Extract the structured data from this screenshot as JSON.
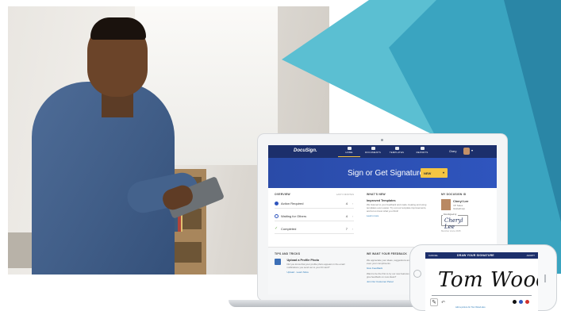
{
  "nav": {
    "logo": "DocuSign.",
    "items": [
      {
        "label": "HOME",
        "active": true
      },
      {
        "label": "DOCUMENTS",
        "active": false
      },
      {
        "label": "TEMPLATES",
        "active": false
      },
      {
        "label": "REPORTS",
        "active": false
      }
    ],
    "user_name": "Chery"
  },
  "hero": {
    "title": "Sign or Get Signatures",
    "new_button": "NEW"
  },
  "overview": {
    "heading": "OVERVIEW",
    "subheading": "LAST 6 MONTHS",
    "rows": [
      {
        "label": "Action Required",
        "count": "4",
        "color": "#2f55be"
      },
      {
        "label": "Waiting for Others",
        "count": "4",
        "color": "#2f55be"
      },
      {
        "label": "Completed",
        "count": "7",
        "color": "#6aa84f"
      }
    ]
  },
  "whats_new": {
    "heading": "WHAT'S NEW",
    "title": "Improved Templates",
    "body": "We listened to your feedback and made creating and using templates even easier. Try out our template improvements, and let us know what you think!",
    "link": "Learn more"
  },
  "identity": {
    "heading": "MY DOCUSIGN ID",
    "name": "Cheryl Lee",
    "role": "VP Sales",
    "company": "GlobalCorp",
    "sig_label": "DocuSigned by:",
    "signature": "Cheryl Lee",
    "date": "Member since 2015"
  },
  "tips": {
    "heading": "TIPS AND TRICKS",
    "title": "Upload a Profile Photo",
    "body": "Did you know that your profile photo appears in the email notifications you send out to your ID card?",
    "link": "Upload · Learn More"
  },
  "feedback": {
    "heading": "WE WANT YOUR FEEDBACK",
    "body1": "We appreciate your ideas, suggestions and even your compliments.",
    "link1": "Give Feedback",
    "body2": "Want to be the first to try our new features and give feedback on new ideas?",
    "link2": "Join Our Customer Panel"
  },
  "phone": {
    "cancel": "CANCEL",
    "title": "DRAW YOUR SIGNATURE",
    "done": "ADOPT",
    "signature": "Tom Wood",
    "link": "Add a picture for Tom Wood also",
    "swatches": [
      "#111111",
      "#2f55be",
      "#d0312d"
    ]
  },
  "colors": {
    "teal_light": "#5bbfd2",
    "teal_mid": "#3aa4c0",
    "teal_dark": "#2a86a6",
    "navy": "#1c2f6b",
    "accent_yellow": "#f5c542"
  }
}
